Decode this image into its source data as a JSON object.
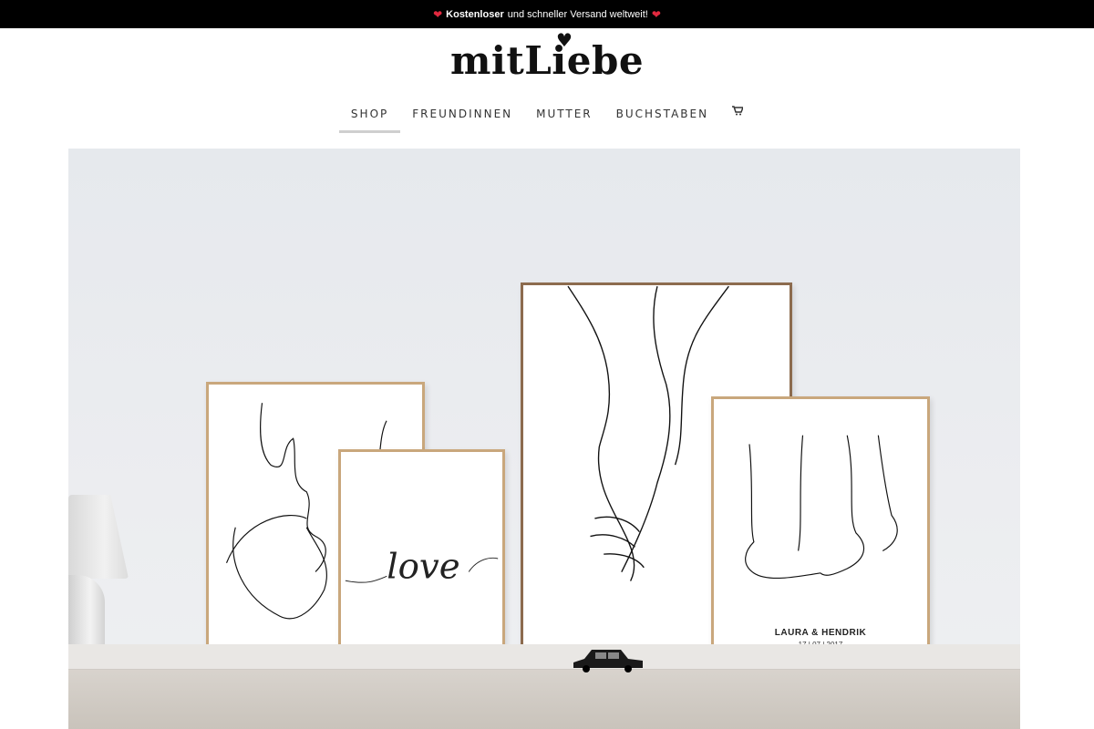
{
  "announcement": {
    "bold_text": "Kostenloser",
    "text": "und schneller Versand weltweit!",
    "heart_icon": "heart-icon",
    "heart_color": "#e2293f"
  },
  "logo": {
    "text": "mitLiebe"
  },
  "nav": {
    "items": [
      {
        "label": "SHOP",
        "active": true
      },
      {
        "label": "FREUNDINNEN",
        "active": false
      },
      {
        "label": "MUTTER",
        "active": false
      },
      {
        "label": "BUCHSTABEN",
        "active": false
      }
    ],
    "cart_icon": "cart-icon"
  },
  "hero": {
    "poster_love_text": "love",
    "poster_names": "LAURA & HENDRIK",
    "poster_date": "17 | 07 | 2017"
  }
}
